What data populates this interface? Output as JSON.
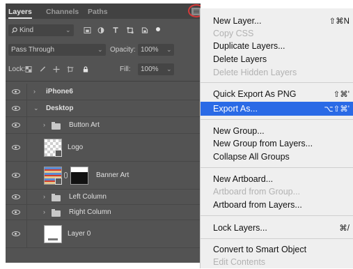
{
  "tabs": [
    "Layers",
    "Channels",
    "Paths"
  ],
  "filter": {
    "kind_label": "Kind"
  },
  "blend": {
    "mode": "Pass Through",
    "opacity_label": "Opacity:",
    "opacity_value": "100%"
  },
  "lock": {
    "label": "Lock:",
    "fill_label": "Fill:",
    "fill_value": "100%"
  },
  "layers": [
    {
      "name": "iPhone6",
      "type": "artboard",
      "expanded": false
    },
    {
      "name": "Desktop",
      "type": "artboard",
      "expanded": true
    },
    {
      "name": "Button Art",
      "type": "group"
    },
    {
      "name": "Logo",
      "type": "smart-object"
    },
    {
      "name": "Banner Art",
      "type": "masked-smart-object"
    },
    {
      "name": "Left Column",
      "type": "group"
    },
    {
      "name": "Right Column",
      "type": "group"
    },
    {
      "name": "Layer 0",
      "type": "smart-object"
    }
  ],
  "menu": [
    {
      "label": "New Layer...",
      "shortcut": "⇧⌘N",
      "disabled": false,
      "highlighted": false
    },
    {
      "label": "Copy CSS",
      "shortcut": "",
      "disabled": true,
      "highlighted": false
    },
    {
      "label": "Duplicate Layers...",
      "shortcut": "",
      "disabled": false,
      "highlighted": false
    },
    {
      "label": "Delete Layers",
      "shortcut": "",
      "disabled": false,
      "highlighted": false
    },
    {
      "label": "Delete Hidden Layers",
      "shortcut": "",
      "disabled": true,
      "highlighted": false
    },
    {
      "label": "Quick Export As PNG",
      "shortcut": "⇧⌘'",
      "disabled": false,
      "highlighted": false
    },
    {
      "label": "Export As...",
      "shortcut": "⌥⇧⌘'",
      "disabled": false,
      "highlighted": true
    },
    {
      "label": "New Group...",
      "shortcut": "",
      "disabled": false,
      "highlighted": false
    },
    {
      "label": "New Group from Layers...",
      "shortcut": "",
      "disabled": false,
      "highlighted": false
    },
    {
      "label": "Collapse All Groups",
      "shortcut": "",
      "disabled": false,
      "highlighted": false
    },
    {
      "label": "New Artboard...",
      "shortcut": "",
      "disabled": false,
      "highlighted": false
    },
    {
      "label": "Artboard from Group...",
      "shortcut": "",
      "disabled": true,
      "highlighted": false
    },
    {
      "label": "Artboard from Layers...",
      "shortcut": "",
      "disabled": false,
      "highlighted": false
    },
    {
      "label": "Lock Layers...",
      "shortcut": "⌘/",
      "disabled": false,
      "highlighted": false
    },
    {
      "label": "Convert to Smart Object",
      "shortcut": "",
      "disabled": false,
      "highlighted": false
    },
    {
      "label": "Edit Contents",
      "shortcut": "",
      "disabled": true,
      "highlighted": false
    }
  ],
  "colors": {
    "highlight": "#2a6ae6",
    "panel": "#535353",
    "annotation": "#d63a3a"
  }
}
